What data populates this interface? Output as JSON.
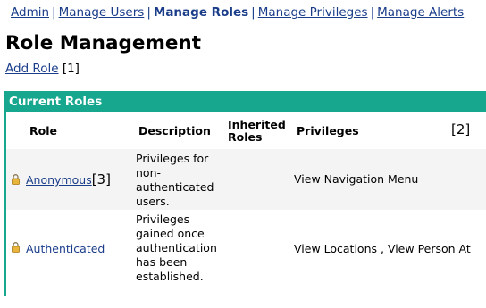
{
  "nav": {
    "items": [
      {
        "label": "Admin",
        "current": false
      },
      {
        "label": "Manage Users",
        "current": false
      },
      {
        "label": "Manage Roles",
        "current": true
      },
      {
        "label": "Manage Privileges",
        "current": false
      },
      {
        "label": "Manage Alerts",
        "current": false
      }
    ],
    "separator": "|"
  },
  "page": {
    "title": "Role Management",
    "add_role": "Add Role",
    "add_role_marker": "[1]"
  },
  "panel": {
    "header": "Current Roles",
    "columns": {
      "role": "Role",
      "description": "Description",
      "inherited_roles": "Inherited Roles",
      "privileges": "Privileges"
    },
    "header_marker": "[2]",
    "rows": [
      {
        "role": "Anonymous",
        "role_marker": "[3]",
        "icon": "lock-icon",
        "description": "Privileges for non-authenticated users.",
        "inherited_roles": "",
        "privileges": "View Navigation Menu"
      },
      {
        "role": "Authenticated",
        "role_marker": "",
        "icon": "lock-icon",
        "description": "Privileges gained once authentication has been established.",
        "inherited_roles": "",
        "privileges": "View Locations , View Person At"
      }
    ]
  },
  "colors": {
    "accent": "#17a78f",
    "link": "#1a3d8a",
    "row_alt": "#f4f4f4"
  }
}
